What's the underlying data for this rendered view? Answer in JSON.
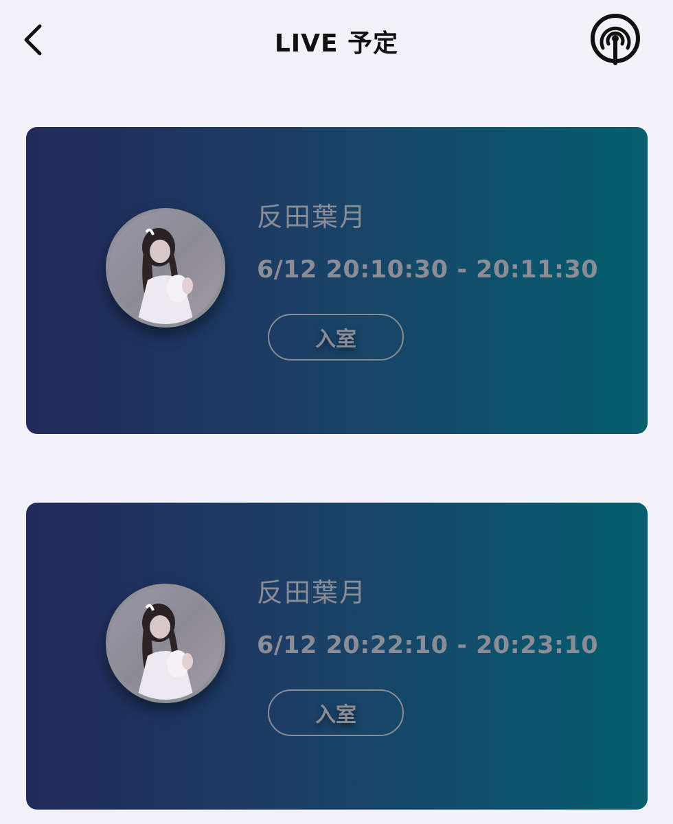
{
  "header": {
    "title": "LIVE 予定",
    "back_icon": "chevron-left-icon",
    "live_icon": "broadcast-icon"
  },
  "colors": {
    "background": "#f2f1f7",
    "card_gradient_start": "#222a5a",
    "card_gradient_end": "#055e6e",
    "muted_text": "#8a8d96"
  },
  "schedules": [
    {
      "name": "反田葉月",
      "time": "6/12 20:10:30 - 20:11:30",
      "button_label": "入室"
    },
    {
      "name": "反田葉月",
      "time": "6/12 20:22:10 - 20:23:10",
      "button_label": "入室"
    }
  ]
}
